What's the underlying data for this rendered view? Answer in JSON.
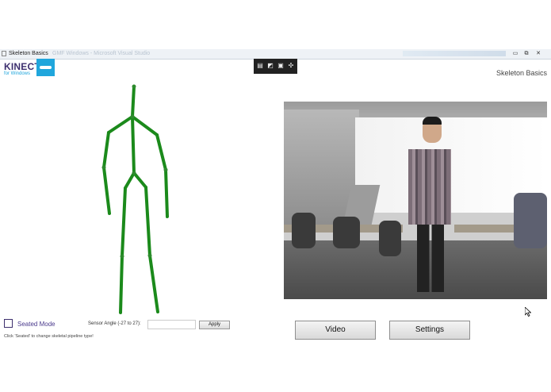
{
  "window": {
    "title": "Skeleton Basics",
    "ghost_title": "GMF Windows - Microsoft Visual Studio"
  },
  "window_controls": {
    "minimize": "▭",
    "restore": "⧉",
    "close": "✕"
  },
  "logo": {
    "name": "KINECT",
    "sub": "for Windows",
    "color": "#20a6dc",
    "text_color": "#3d2f6e"
  },
  "toolbar": {
    "icons": [
      "select-element-icon",
      "display-layout-icon",
      "track-focus-icon",
      "enable-selection-icon"
    ]
  },
  "header": {
    "title": "Skeleton Basics"
  },
  "skeleton": {
    "color": "#1b8a1b",
    "joint_color": "#2e8b2e"
  },
  "controls": {
    "seated_label": "Seated Mode",
    "seated_checked": false,
    "angle_label": "Sensor Angle (-27 to 27):",
    "angle_value": "",
    "apply_label": "Apply",
    "hint": "Click 'Seated' to change skeletal pipeline type!"
  },
  "buttons": {
    "video": "Video",
    "settings": "Settings"
  }
}
